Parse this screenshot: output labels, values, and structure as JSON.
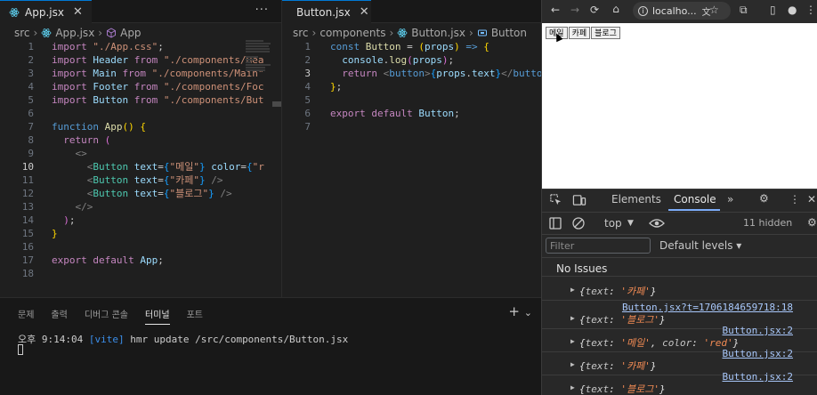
{
  "left_editor": {
    "tab_label": "App.jsx",
    "tab_close": "✕",
    "more": "···",
    "breadcrumb": [
      "src",
      "App.jsx",
      "App"
    ],
    "lines": [
      {
        "n": "1",
        "html": "<span class=\"k\">import</span> <span class=\"s\">\"./App.css\"</span>;"
      },
      {
        "n": "2",
        "html": "<span class=\"k\">import</span> <span class=\"v\">Header</span> <span class=\"k\">from</span> <span class=\"s\">\"./components/Hea</span>"
      },
      {
        "n": "3",
        "html": "<span class=\"k\">import</span> <span class=\"v\">Main</span> <span class=\"k\">from</span> <span class=\"s\">\"./components/Main\"</span>"
      },
      {
        "n": "4",
        "html": "<span class=\"k\">import</span> <span class=\"v\">Footer</span> <span class=\"k\">from</span> <span class=\"s\">\"./components/Foc</span>"
      },
      {
        "n": "5",
        "html": "<span class=\"k\">import</span> <span class=\"v\">Button</span> <span class=\"k\">from</span> <span class=\"s\">\"./components/But</span>"
      },
      {
        "n": "6",
        "html": ""
      },
      {
        "n": "7",
        "html": "<span class=\"kb\">function</span> <span class=\"f\">App</span><span class=\"y\">()</span> <span class=\"y\">{</span>"
      },
      {
        "n": "8",
        "html": "  <span class=\"k\">return</span> <span class=\"p\">(</span>"
      },
      {
        "n": "9",
        "html": "    <span class=\"tag\">&lt;&gt;</span>"
      },
      {
        "n": "10",
        "html": "      <span class=\"tag\">&lt;</span><span class=\"tn\">Button</span> <span class=\"v\">text</span>=<span class=\"b\">{</span><span class=\"s\">\"메일\"</span><span class=\"b\">}</span> <span class=\"v\">color</span>=<span class=\"b\">{</span><span class=\"s\">\"r</span>"
      },
      {
        "n": "11",
        "html": "      <span class=\"tag\">&lt;</span><span class=\"tn\">Button</span> <span class=\"v\">text</span>=<span class=\"b\">{</span><span class=\"s\">\"카페\"</span><span class=\"b\">}</span> <span class=\"tag\">/&gt;</span>"
      },
      {
        "n": "12",
        "html": "      <span class=\"tag\">&lt;</span><span class=\"tn\">Button</span> <span class=\"v\">text</span>=<span class=\"b\">{</span><span class=\"s\">\"블로그\"</span><span class=\"b\">}</span> <span class=\"tag\">/&gt;</span>"
      },
      {
        "n": "13",
        "html": "    <span class=\"tag\">&lt;/&gt;</span>"
      },
      {
        "n": "14",
        "html": "  <span class=\"p\">)</span>;"
      },
      {
        "n": "15",
        "html": "<span class=\"y\">}</span>"
      },
      {
        "n": "16",
        "html": ""
      },
      {
        "n": "17",
        "html": "<span class=\"k\">export</span> <span class=\"k\">default</span> <span class=\"v\">App</span>;"
      },
      {
        "n": "18",
        "html": ""
      }
    ],
    "current_line": "10"
  },
  "right_editor": {
    "tab_label": "Button.jsx",
    "tab_close": "✕",
    "breadcrumb": [
      "src",
      "components",
      "Button.jsx",
      "Button"
    ],
    "lines": [
      {
        "n": "1",
        "html": "<span class=\"kb\">const</span> <span class=\"f\">Button</span> = <span class=\"y\">(</span><span class=\"v\">props</span><span class=\"y\">)</span> <span class=\"kb\">=&gt;</span> <span class=\"y\">{</span>"
      },
      {
        "n": "2",
        "html": "  <span class=\"v\">console</span>.<span class=\"f\">log</span><span class=\"p\">(</span><span class=\"v\">props</span><span class=\"p\">)</span>;"
      },
      {
        "n": "3",
        "html": "  <span class=\"k\">return</span> <span class=\"tag\">&lt;</span><span class=\"kb\">button</span><span class=\"tag\">&gt;</span><span class=\"b\">{</span><span class=\"v\">props</span>.<span class=\"v\">text</span><span class=\"b\">}</span><span class=\"tag\">&lt;/</span><span class=\"kb\">button</span><span class=\"tag\">&gt;</span>;"
      },
      {
        "n": "4",
        "html": "<span class=\"y\">}</span>;"
      },
      {
        "n": "5",
        "html": ""
      },
      {
        "n": "6",
        "html": "<span class=\"k\">export</span> <span class=\"k\">default</span> <span class=\"v\">Button</span>;"
      },
      {
        "n": "7",
        "html": ""
      }
    ],
    "current_line": "3"
  },
  "panel": {
    "tabs": [
      "문제",
      "출력",
      "디버그 콘솔",
      "터미널",
      "포트"
    ],
    "active_tab": "터미널",
    "add_icon": "+",
    "chevron": "⌄",
    "terminal_line": {
      "time": "오후 9:14:04",
      "tag": "[vite]",
      "msg": "hmr update /src/components/Button.jsx"
    }
  },
  "browser": {
    "url": "localho...",
    "nav": {
      "back": "←",
      "forward": "→",
      "reload": "⟳",
      "home": "⌂"
    },
    "page_buttons": [
      "메일",
      "카페",
      "블로그"
    ],
    "devtools": {
      "tabs": {
        "elements": "Elements",
        "console": "Console",
        "more": "»"
      },
      "context": "top",
      "hidden_count": "11 hidden",
      "filter_placeholder": "Filter",
      "levels": "Default levels ▾",
      "no_issues": "No Issues",
      "entries": [
        {
          "tri": "▶",
          "text": "'카페'",
          "color": "",
          "link": ""
        },
        {
          "tri": "▶",
          "text": "'블로그'",
          "color": "",
          "link": "Button.jsx?t=1706184659718:18"
        },
        {
          "tri": "▶",
          "text": "'메일'",
          "color": "'red'",
          "link": "Button.jsx:2"
        },
        {
          "tri": "▶",
          "text": "'카페'",
          "color": "",
          "link": "Button.jsx:2"
        },
        {
          "tri": "▶",
          "text": "'블로그'",
          "color": "",
          "link": "Button.jsx:2"
        }
      ]
    }
  }
}
